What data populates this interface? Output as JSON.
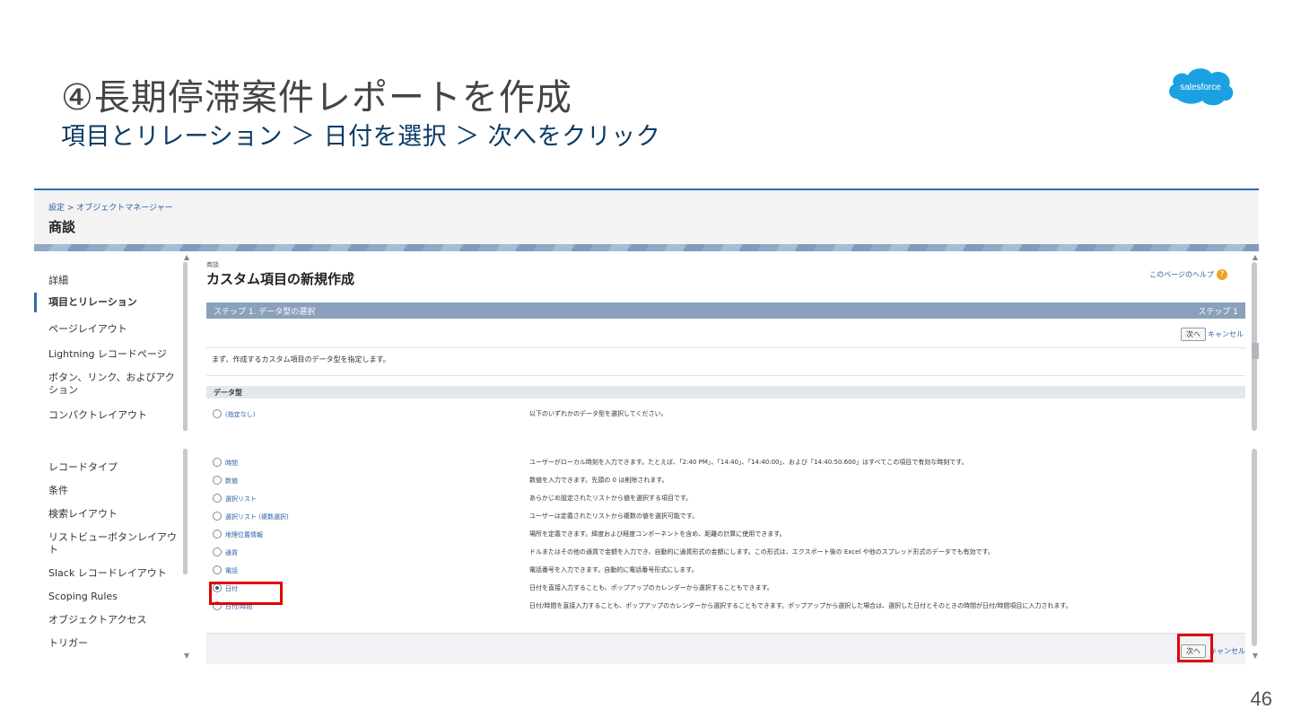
{
  "slide": {
    "title": "④長期停滞案件レポートを作成",
    "subtitle": "項目とリレーション ＞ 日付を選択 ＞ 次へをクリック",
    "logo_text": "salesforce",
    "page_number": "46"
  },
  "colors": {
    "accent": "#2c6eb3",
    "highlight": "#e00000",
    "logo": "#1ba1e2",
    "step_bar": "#8aa0bb"
  },
  "header": {
    "breadcrumb": "設定 > オブジェクトマネージャー",
    "object_name": "商談"
  },
  "sidebar": {
    "items": [
      "詳細",
      "項目とリレーション",
      "ページレイアウト",
      "Lightning レコードページ",
      "ボタン、リンク、およびアク",
      "ション",
      "コンパクトレイアウト",
      "レコードタイプ",
      "条件",
      "検索レイアウト",
      "リストビューボタンレイアウ",
      "ト",
      "Slack レコードレイアウト",
      "Scoping Rules",
      "オブジェクトアクセス",
      "トリガー"
    ]
  },
  "main": {
    "object_small": "商談",
    "page_title": "カスタム項目の新規作成",
    "help_link": "このページのヘルプ",
    "step_title": "ステップ 1. データ型の選択",
    "step_indicator": "ステップ 1",
    "next_button": "次へ",
    "cancel_link": "キャンセル",
    "instruction": "まず、作成するカスタム項目のデータ型を指定します。",
    "data_type_header": "データ型",
    "upper_rows": [
      {
        "label": "(指定なし)",
        "desc": "以下のいずれかのデータ型を選択してください。"
      }
    ],
    "lower_rows": [
      {
        "label": "時間",
        "desc": "ユーザーがローカル時刻を入力できます。たとえば、「2:40 PM」、「14:40」、「14:40:00」、および「14:40:50.600」はすべてこの項目で有効な時刻です。"
      },
      {
        "label": "数値",
        "desc": "数値を入力できます。先頭の 0 は削除されます。"
      },
      {
        "label": "選択リスト",
        "desc": "あらかじめ設定されたリストから値を選択する項目です。"
      },
      {
        "label": "選択リスト (複数選択)",
        "desc": "ユーザーは定義されたリストから複数の値を選択可能です。"
      },
      {
        "label": "地理位置情報",
        "desc": "場所を定義できます。緯度および経度コンポーネントを含め、距離の計算に使用できます。"
      },
      {
        "label": "通貨",
        "desc": "ドルまたはその他の通貨で金額を入力でき、自動的に通貨形式の金額にします。この形式は、エクスポート後の Excel や他のスプレッド形式のデータでも有効です。"
      },
      {
        "label": "電話",
        "desc": "電話番号を入力できます。自動的に電話番号形式にします。"
      },
      {
        "label": "日付",
        "desc": "日付を直接入力することも、ポップアップのカレンダーから選択することもできます。"
      },
      {
        "label": "日付/時間",
        "desc": "日付/時間を直接入力することも、ポップアップのカレンダーから選択することもできます。ポップアップから選択した場合は、選択した日付とそのときの時間が日付/時間項目に入力されます。"
      }
    ],
    "selected_type": "日付"
  }
}
